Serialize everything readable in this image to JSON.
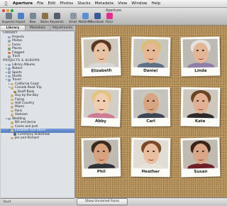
{
  "menubar": {
    "app": "Aperture",
    "items": [
      "File",
      "Edit",
      "Photos",
      "Stacks",
      "Metadata",
      "View",
      "Window",
      "Help"
    ]
  },
  "window": {
    "title": "Aperture"
  },
  "toolbar": {
    "buttons": [
      {
        "label": "Inspector",
        "icon": "inspector-icon",
        "color": "#6e7a88"
      },
      {
        "label": "Import",
        "icon": "import-icon",
        "color": "#4d7fc9"
      },
      {
        "label": "New",
        "icon": "new-icon",
        "color": "#7a8596"
      },
      {
        "label": "Name",
        "icon": "name-icon",
        "color": "#8b6f47"
      },
      {
        "label": "Keywords",
        "icon": "keywords-icon",
        "color": "#555d69"
      },
      {
        "label": "Email",
        "icon": "email-icon",
        "color": "#8c96a3"
      },
      {
        "label": "MobileMe",
        "icon": "cloud-icon",
        "color": "#5a8fd3"
      },
      {
        "label": "Facebook",
        "icon": "facebook-icon",
        "color": "#3b5998"
      },
      {
        "label": "Flickr",
        "icon": "flickr-icon",
        "color": "#e0308f"
      }
    ]
  },
  "tabs": [
    "Library",
    "Metadata",
    "Adjustments"
  ],
  "sidebar": {
    "sections": [
      {
        "header": "LIBRARY",
        "rows": [
          {
            "label": "Projects",
            "indent": 1,
            "tri": "",
            "icon": "#8ea1bf"
          },
          {
            "label": "Photos",
            "indent": 1,
            "tri": "",
            "icon": "#9aa6b5"
          },
          {
            "label": "Faces",
            "indent": 1,
            "tri": "",
            "icon": "#d6b18c"
          },
          {
            "label": "Places",
            "indent": 1,
            "tri": "",
            "icon": "#7aa36a"
          },
          {
            "label": "Flagged",
            "indent": 1,
            "tri": "",
            "icon": "#d9792f"
          },
          {
            "label": "Trash",
            "indent": 1,
            "tri": "",
            "icon": "#9aa0a8"
          }
        ]
      },
      {
        "header": "PROJECTS & ALBUMS",
        "rows": [
          {
            "label": "Library Albums",
            "indent": 1,
            "tri": "▸",
            "icon": "#8ea1bf"
          },
          {
            "label": "Nature",
            "indent": 1,
            "tri": "▸",
            "icon": "#8ea1bf"
          },
          {
            "label": "Sports",
            "indent": 1,
            "tri": "▸",
            "icon": "#8ea1bf"
          },
          {
            "label": "Studio",
            "indent": 1,
            "tri": "▸",
            "icon": "#8ea1bf"
          },
          {
            "label": "Travel",
            "indent": 1,
            "tri": "▾",
            "icon": "#8ea1bf"
          },
          {
            "label": "California Coast",
            "indent": 2,
            "tri": "▸",
            "icon": "#c9b27d"
          },
          {
            "label": "Canada Road Trip",
            "indent": 2,
            "tri": "▾",
            "icon": "#c9b27d"
          },
          {
            "label": "Banff Book",
            "indent": 3,
            "tri": "",
            "icon": "#b0843f"
          },
          {
            "label": "Day by the Bay",
            "indent": 2,
            "tri": "",
            "icon": "#c9b27d"
          },
          {
            "label": "Flying",
            "indent": 2,
            "tri": "",
            "icon": "#c9b27d"
          },
          {
            "label": "Holt Country",
            "indent": 2,
            "tri": "",
            "icon": "#c9b27d"
          },
          {
            "label": "Miami",
            "indent": 2,
            "tri": "",
            "icon": "#c9b27d"
          },
          {
            "label": "Paris",
            "indent": 2,
            "tri": "",
            "icon": "#c9b27d"
          },
          {
            "label": "Vietnam",
            "indent": 2,
            "tri": "",
            "icon": "#c9b27d"
          },
          {
            "label": "Wedding",
            "indent": 1,
            "tri": "▾",
            "icon": "#8ea1bf"
          },
          {
            "label": "Bill and Jenna",
            "indent": 2,
            "tri": "",
            "icon": "#c9b27d"
          },
          {
            "label": "Carrie and Josh",
            "indent": 2,
            "tri": "",
            "icon": "#c9b27d"
          },
          {
            "label": "Elizabeth and David",
            "indent": 2,
            "tri": "▾",
            "icon": "#c9b27d",
            "selected": true
          },
          {
            "label": "Ceremony Slideshow",
            "indent": 3,
            "tri": "",
            "icon": "#5f6c7d"
          },
          {
            "label": "Jen and Richard",
            "indent": 2,
            "tri": "",
            "icon": "#c9b27d"
          }
        ]
      }
    ]
  },
  "statusbar": {
    "text": "Vault"
  },
  "faces": [
    {
      "name": "Elizabeth",
      "hair": "#5a3822",
      "skin": "#e8c2a4",
      "shirt": "#d8d8d8",
      "bg": "#cfc8bd"
    },
    {
      "name": "Daniel",
      "hair": "#d9bd7c",
      "skin": "#e6b896",
      "shirt": "#5e6f86",
      "bg": "#c9c6be"
    },
    {
      "name": "Linda",
      "hair": "#e4e2dc",
      "skin": "#e3b698",
      "shirt": "#8f7fa8",
      "bg": "#bdbab4"
    },
    {
      "name": "Abby",
      "hair": "#e3c483",
      "skin": "#f0cdb1",
      "shirt": "#cc7d93",
      "bg": "#d4cfc6"
    },
    {
      "name": "Carl",
      "hair": "#c9c6c0",
      "skin": "#d8a583",
      "shirt": "#3e4654",
      "bg": "#c6c2bc"
    },
    {
      "name": "Kate",
      "hair": "#6a4426",
      "skin": "#e1b092",
      "shirt": "#2e2a2a",
      "bg": "#cdc7bd"
    },
    {
      "name": "Phil",
      "hair": "#3a2a1e",
      "skin": "#d9a27e",
      "shirt": "#2f3338",
      "bg": "#bfbab2"
    },
    {
      "name": "Heather",
      "hair": "#7a4a2a",
      "skin": "#e9bea1",
      "shirt": "#e6e2d8",
      "bg": "#e1ddd4"
    },
    {
      "name": "Susan",
      "hair": "#3a2418",
      "skin": "#d9a688",
      "shirt": "#6f1e2a",
      "bg": "#c1bab1"
    }
  ],
  "bottom": {
    "unnamed_button": "Show Unnamed Faces"
  }
}
